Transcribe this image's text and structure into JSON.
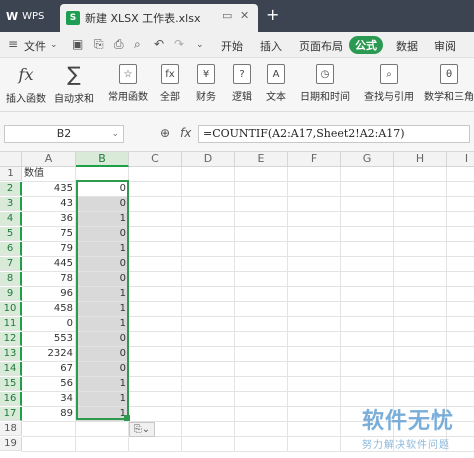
{
  "titlebar": {
    "app_tab": "WPS",
    "doc_tab_title": "新建 XLSX 工作表.xlsx",
    "new_tab": "+"
  },
  "menubar": {
    "items": [
      "文件",
      "开始",
      "插入",
      "页面布局",
      "公式",
      "数据",
      "审阅"
    ],
    "active": "公式"
  },
  "ribbon": {
    "buttons": [
      {
        "label": "插入函数",
        "icon": "fx-icon"
      },
      {
        "label": "自动求和",
        "icon": "sum-icon"
      },
      {
        "label": "常用函数",
        "icon": "fav-function-icon"
      },
      {
        "label": "全部",
        "icon": "all-functions-icon"
      },
      {
        "label": "财务",
        "icon": "finance-icon"
      },
      {
        "label": "逻辑",
        "icon": "logic-icon"
      },
      {
        "label": "文本",
        "icon": "text-icon"
      },
      {
        "label": "日期和时间",
        "icon": "datetime-icon"
      },
      {
        "label": "查找与引用",
        "icon": "lookup-icon"
      },
      {
        "label": "数学和三角",
        "icon": "math-icon"
      }
    ]
  },
  "formula_bar": {
    "cell_ref": "B2",
    "fx": "fx",
    "formula": "=COUNTIF(A2:A17,Sheet2!A2:A17)"
  },
  "sheet": {
    "columns": [
      "A",
      "B",
      "C",
      "D",
      "E",
      "F",
      "G",
      "H",
      "I"
    ],
    "rows": [
      "1",
      "2",
      "3",
      "4",
      "5",
      "6",
      "7",
      "8",
      "9",
      "10",
      "11",
      "12",
      "13",
      "14",
      "15",
      "16",
      "17",
      "18",
      "19"
    ],
    "header_cell": "数值",
    "col_a": [
      "435",
      "43",
      "36",
      "75",
      "79",
      "445",
      "78",
      "96",
      "458",
      "0",
      "553",
      "2324",
      "67",
      "56",
      "34",
      "89"
    ],
    "col_b": [
      "0",
      "0",
      "1",
      "0",
      "1",
      "0",
      "0",
      "1",
      "1",
      "1",
      "0",
      "0",
      "0",
      "1",
      "1",
      "1"
    ]
  },
  "watermark": {
    "title": "软件无忧",
    "subtitle": "努力解决软件问题"
  }
}
